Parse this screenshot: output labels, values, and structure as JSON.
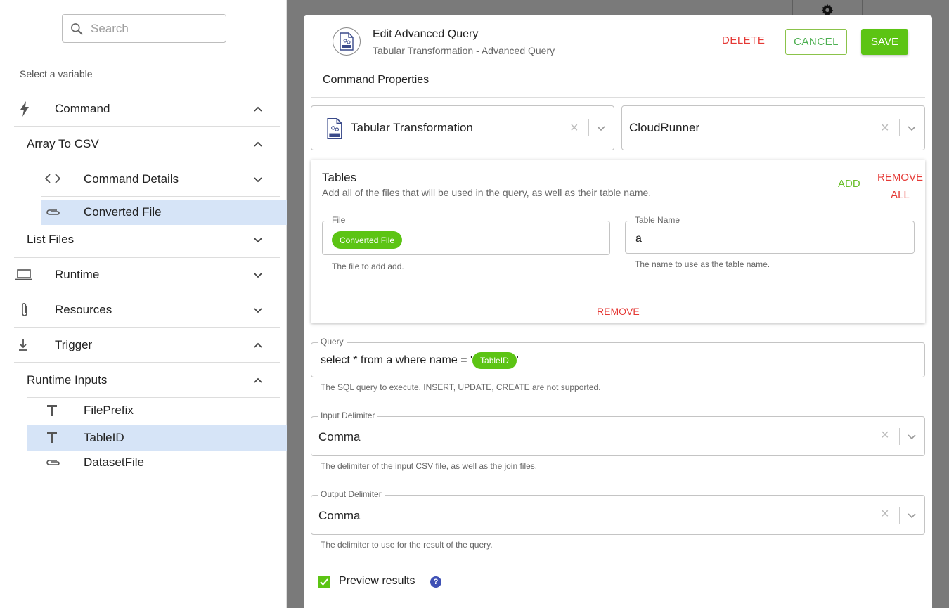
{
  "sidebar": {
    "search_placeholder": "Search",
    "select_label": "Select a variable",
    "items": {
      "command": "Command",
      "array_to_csv": "Array To CSV",
      "command_details": "Command Details",
      "converted_file": "Converted File",
      "list_files": "List Files",
      "runtime": "Runtime",
      "resources": "Resources",
      "trigger": "Trigger",
      "runtime_inputs": "Runtime Inputs",
      "file_prefix": "FilePrefix",
      "table_id": "TableID",
      "dataset_file": "DatasetFile"
    },
    "icons": [
      "search-icon",
      "lightning-icon",
      "code-icon",
      "paperclip-icon",
      "laptop-icon",
      "attachment-icon",
      "download-icon",
      "text-icon",
      "chevron-up-icon",
      "chevron-down-icon"
    ]
  },
  "dialog": {
    "title": "Edit Advanced Query",
    "subtitle": "Tabular Transformation - Advanced Query",
    "delete_label": "DELETE",
    "cancel_label": "CANCEL",
    "save_label": "SAVE",
    "section_title": "Command Properties",
    "command_select": "Tabular Transformation",
    "runner_select": "CloudRunner",
    "tables": {
      "title": "Tables",
      "description": "Add all of the files that will be used in the query, as well as their table name.",
      "add_label": "ADD",
      "remove_all_line1": "REMOVE",
      "remove_all_line2": "ALL",
      "file_legend": "File",
      "file_chip": "Converted File",
      "file_helper": "The file to add add.",
      "table_name_legend": "Table Name",
      "table_name_value": "a",
      "table_name_helper": "The name to use as the table name.",
      "remove_label": "REMOVE"
    },
    "query": {
      "legend": "Query",
      "text_before": "select * from a where name = '",
      "chip": "TableID",
      "text_after": "'",
      "helper": "The SQL query to execute. INSERT, UPDATE, CREATE are not supported."
    },
    "input_delimiter": {
      "legend": "Input Delimiter",
      "value": "Comma",
      "helper": "The delimiter of the input CSV file, as well as the join files."
    },
    "output_delimiter": {
      "legend": "Output Delimiter",
      "value": "Comma",
      "helper": "The delimiter to use for the result of the query."
    },
    "preview_label": "Preview results",
    "preview_checked": true,
    "help_glyph": "?"
  },
  "colors": {
    "accent_green": "#5cc414",
    "danger_red": "#e53935",
    "selection_blue": "#d6e4f7",
    "help_blue": "#3f51b5"
  }
}
